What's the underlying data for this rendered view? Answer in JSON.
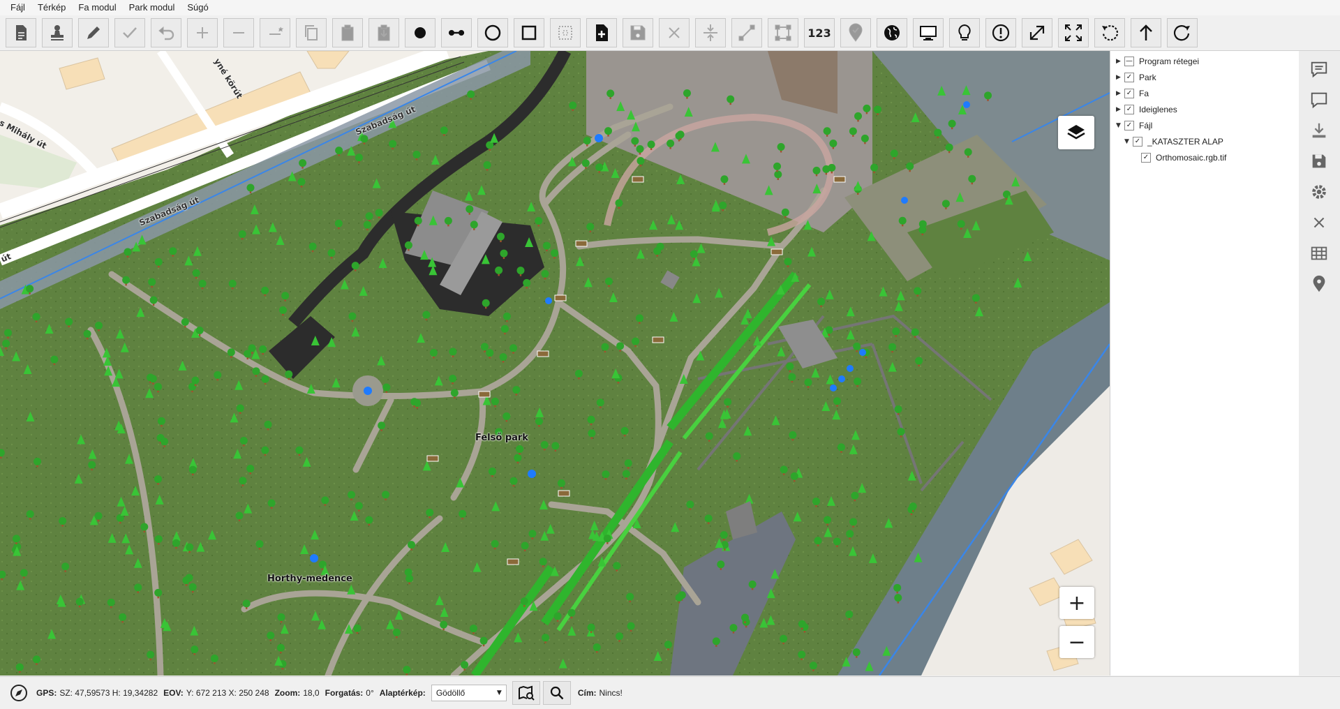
{
  "menu": [
    "Fájl",
    "Térkép",
    "Fa modul",
    "Park modul",
    "Súgó"
  ],
  "toolbar": {
    "items": [
      {
        "name": "new-document-button",
        "icon": "document-icon"
      },
      {
        "name": "stamp-button",
        "icon": "stamp-icon"
      },
      {
        "name": "edit-button",
        "icon": "pencil-icon"
      },
      {
        "name": "confirm-button",
        "icon": "check-icon"
      },
      {
        "name": "undo-button",
        "icon": "undo-icon"
      },
      {
        "name": "add-button",
        "icon": "plus-icon"
      },
      {
        "name": "remove-button",
        "icon": "minus-icon"
      },
      {
        "name": "remove-alt-button",
        "icon": "minus-star-icon"
      },
      {
        "name": "copy-button",
        "icon": "copy-icon"
      },
      {
        "name": "paste-button",
        "icon": "clipboard-icon"
      },
      {
        "name": "paste-down-button",
        "icon": "clipboard-download-icon"
      },
      {
        "name": "point-tool-button",
        "icon": "point-icon"
      },
      {
        "name": "line-tool-button",
        "icon": "line-icon"
      },
      {
        "name": "circle-tool-button",
        "icon": "circle-icon"
      },
      {
        "name": "rectangle-tool-button",
        "icon": "square-icon"
      },
      {
        "name": "dotted-rect-button",
        "icon": "dotted-rect-icon"
      },
      {
        "name": "add-file-button",
        "icon": "file-plus-icon"
      },
      {
        "name": "save-button",
        "icon": "floppy-icon"
      },
      {
        "name": "delete-button",
        "icon": "x-icon"
      },
      {
        "name": "merge-button",
        "icon": "merge-icon"
      },
      {
        "name": "measure-button",
        "icon": "measure-icon"
      },
      {
        "name": "bounding-box-button",
        "icon": "bbox-icon"
      },
      {
        "name": "numbers-button",
        "icon": "numbers-icon",
        "text": "123"
      },
      {
        "name": "verify-location-button",
        "icon": "location-check-icon"
      },
      {
        "name": "globe-button",
        "icon": "globe-icon"
      },
      {
        "name": "monitor-button",
        "icon": "monitor-icon"
      },
      {
        "name": "bulb-button",
        "icon": "lightbulb-icon"
      },
      {
        "name": "alert-button",
        "icon": "alert-icon"
      },
      {
        "name": "expand-button",
        "icon": "expand-icon"
      },
      {
        "name": "fullscreen-button",
        "icon": "fullscreen-icon"
      },
      {
        "name": "rotate-left-button",
        "icon": "rotate-left-icon"
      },
      {
        "name": "north-button",
        "icon": "arrow-up-icon"
      },
      {
        "name": "rotate-right-button",
        "icon": "rotate-right-icon"
      }
    ]
  },
  "map": {
    "labels": {
      "felso_park": "Felső park",
      "horthy": "Horthy-medence"
    },
    "streets": {
      "s1": "Szabadság út",
      "s2": "Szabadság út",
      "s3": "út",
      "s4": "s Mihály út",
      "s5": "yné körút"
    },
    "colors": {
      "grass": "#5c7f3a",
      "path": "#a9a496",
      "road": "#ffffff",
      "building": "#f7dfb7",
      "water_point": "#1e7bff",
      "asphalt": "#2a2a2a",
      "boundary": "#3a86e8"
    }
  },
  "layers": [
    {
      "label": "Program rétegei",
      "state": "partial",
      "expanded": false,
      "level": 0
    },
    {
      "label": "Park",
      "state": "checked",
      "expanded": false,
      "level": 0
    },
    {
      "label": "Fa",
      "state": "checked",
      "expanded": false,
      "level": 0
    },
    {
      "label": "Ideiglenes",
      "state": "checked",
      "expanded": false,
      "level": 0
    },
    {
      "label": "Fájl",
      "state": "checked",
      "expanded": true,
      "level": 0
    },
    {
      "label": "_KATASZTER ALAP",
      "state": "checked",
      "expanded": true,
      "level": 1
    },
    {
      "label": "Orthomosaic.rgb.tif",
      "state": "checked",
      "expanded": null,
      "level": 2
    }
  ],
  "sidebar": [
    "comment-icon",
    "chat-icon",
    "download-icon",
    "save-icon",
    "settings-icon",
    "close-icon",
    "table-icon",
    "location-pin-icon"
  ],
  "status": {
    "gps_label": "GPS:",
    "gps_value": "SZ: 47,59573 H: 19,34282",
    "eov_label": "EOV:",
    "eov_value": "Y: 672 213 X: 250 248",
    "zoom_label": "Zoom:",
    "zoom_value": "18,0",
    "rotation_label": "Forgatás:",
    "rotation_value": "0°",
    "basemap_label": "Alaptérkép:",
    "basemap_value": "Gödöllő",
    "address_label": "Cím:",
    "address_value": "Nincs!"
  }
}
